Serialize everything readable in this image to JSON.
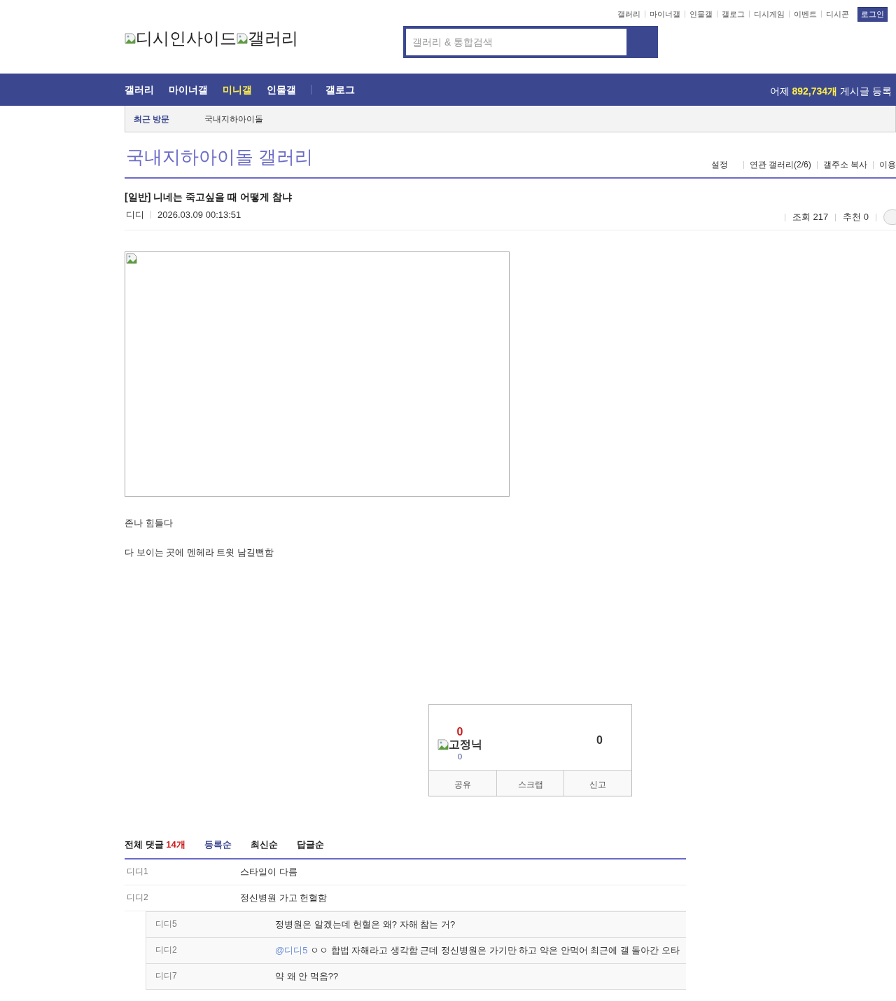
{
  "top_links": [
    "갤러리",
    "마이너갤",
    "인물갤",
    "갤로그",
    "디시게임",
    "이벤트",
    "디시콘"
  ],
  "login_button": "로그인",
  "logo": {
    "site": "디시인사이드",
    "section": "갤러리"
  },
  "search": {
    "placeholder": "갤러리 & 통합검색"
  },
  "nav": [
    {
      "label": "갤러리",
      "selected": false
    },
    {
      "label": "마이너갤",
      "selected": false
    },
    {
      "label": "미니갤",
      "selected": true
    },
    {
      "label": "인물갤",
      "selected": false
    },
    {
      "label": "갤로그",
      "selected": false
    }
  ],
  "nav_stats": {
    "prefix": "어제",
    "count": "892,734개",
    "suffix": "게시글 등록"
  },
  "recent": {
    "label": "최근 방문",
    "items": [
      "국내지하아이돌"
    ]
  },
  "gallery_title": "국내지하아이돌 갤러리",
  "gallery_links": [
    "설정",
    "연관 갤러리(2/6)",
    "갤주소 복사",
    "이용"
  ],
  "post": {
    "title": "[일반] 니네는 죽고싶을 때 어떻게 참냐",
    "author": "디디",
    "date": "2026.03.09 00:13:51",
    "views": "조회 217",
    "recommends": "추천 0",
    "body": [
      "존나 힘들다",
      "다 보이는 곳에 멘헤라 트윗 남길뻔함"
    ]
  },
  "vote": {
    "up_count": "0",
    "fixed_label": "고정닉",
    "fixed_count": "0",
    "down_count": "0",
    "actions": [
      "공유",
      "스크랩",
      "신고"
    ]
  },
  "comments_header": {
    "label": "전체 댓글",
    "count": "14개",
    "sorts": [
      {
        "label": "등록순",
        "selected": true
      },
      {
        "label": "최신순",
        "selected": false
      },
      {
        "label": "답글순",
        "selected": false
      }
    ]
  },
  "comments": [
    {
      "author": "디디1",
      "text": "스타일이 다름"
    },
    {
      "author": "디디2",
      "text": "정신병원 가고 헌혈함",
      "children": [
        {
          "author": "디디5",
          "text": "정병원은 알겠는데 헌혈은 왜? 자해 참는 거?"
        },
        {
          "author": "디디2",
          "mention": "@디디5",
          "text": "ㅇㅇ 합법 자해라고 생각함 근데 정신병원은 가기만 하고 약은 안먹어 최근에 갤 돌아간 오타"
        },
        {
          "author": "디디7",
          "text": "약 왜 안 먹음??"
        }
      ]
    }
  ]
}
